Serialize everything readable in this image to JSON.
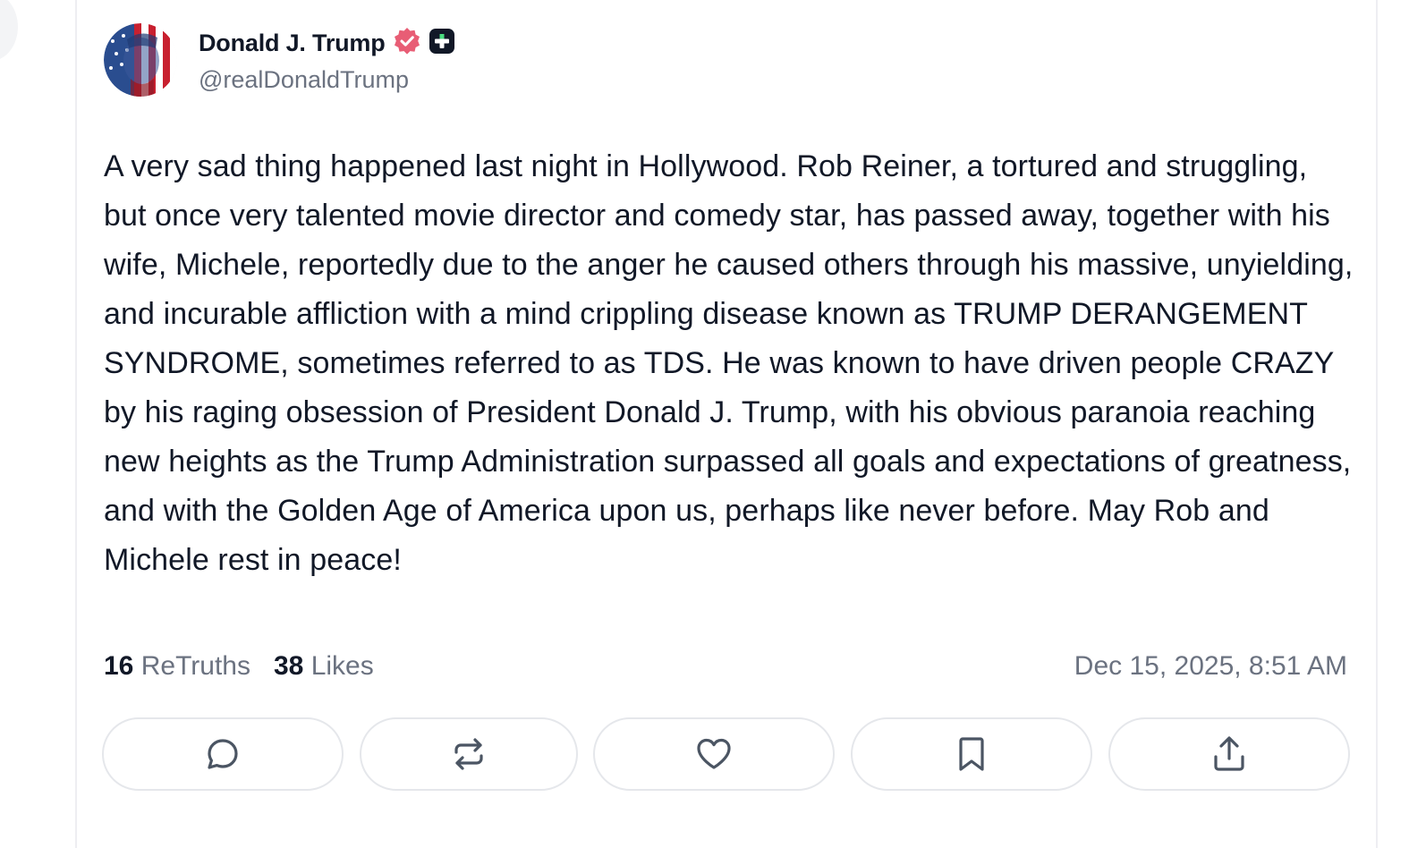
{
  "author": {
    "display_name": "Donald J. Trump",
    "handle": "@realDonaldTrump",
    "verified_badge_color": "#e85d75",
    "plus_badge_color": "#111827"
  },
  "post": {
    "text": "A very sad thing happened last night in Hollywood. Rob Reiner, a tortured and struggling, but once very talented movie director and comedy star, has passed away, together with his wife, Michele, reportedly due to the anger he caused others through his massive, unyielding, and incurable affliction with a mind crippling disease known as TRUMP DERANGEMENT SYNDROME, sometimes referred to as TDS. He was known to have driven people CRAZY by his raging obsession of President Donald J. Trump, with his obvious paranoia reaching new heights as the Trump Administration surpassed all goals and expectations of greatness, and with the Golden Age of America upon us, perhaps like never before. May Rob and Michele rest in peace!",
    "retruths_count": "16",
    "retruths_label": "ReTruths",
    "likes_count": "38",
    "likes_label": "Likes",
    "timestamp": "Dec 15, 2025, 8:51 AM"
  },
  "actions": [
    {
      "icon": "reply-icon"
    },
    {
      "icon": "retruth-icon"
    },
    {
      "icon": "like-icon"
    },
    {
      "icon": "bookmark-icon"
    },
    {
      "icon": "share-icon"
    }
  ],
  "colors": {
    "text_primary": "#111827",
    "text_secondary": "#6b7280",
    "border": "#e5e7eb"
  }
}
